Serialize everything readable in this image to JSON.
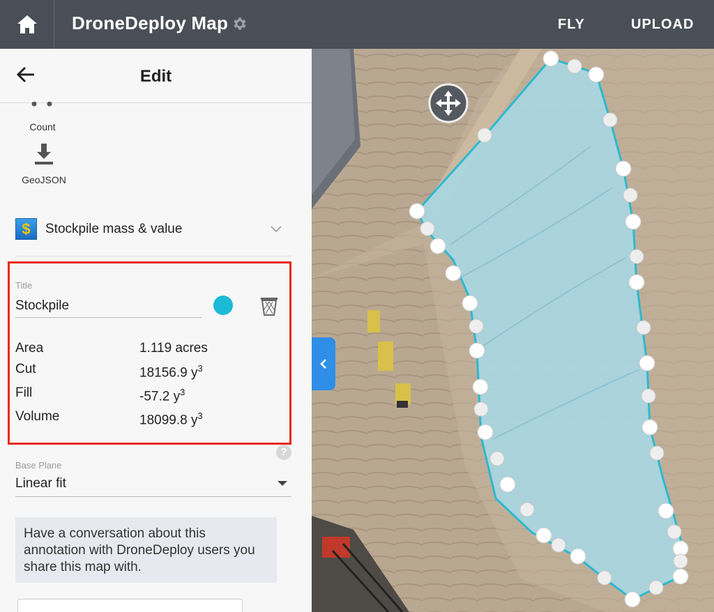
{
  "topbar": {
    "title": "DroneDeploy Map",
    "fly_label": "FLY",
    "upload_label": "UPLOAD",
    "icons": [
      "home-icon",
      "gear-icon"
    ],
    "background_color": "#4a4f57"
  },
  "sidebar": {
    "header": {
      "title": "Edit",
      "back_icon": "arrow-left-icon"
    },
    "tools": [
      {
        "label": "Count",
        "icon": "count-icon"
      },
      {
        "label": "GeoJSON",
        "icon": "download-icon"
      }
    ],
    "stockpile_section": {
      "label": "Stockpile mass & value",
      "icon": "dollar-icon"
    },
    "annotation": {
      "title_label": "Title",
      "title_value": "Stockpile",
      "color": "#1bbad6",
      "metrics": [
        {
          "label": "Area",
          "value": "1.119 acres",
          "sup": ""
        },
        {
          "label": "Cut",
          "value": "18156.9 y",
          "sup": "3"
        },
        {
          "label": "Fill",
          "value": "-57.2 y",
          "sup": "3"
        },
        {
          "label": "Volume",
          "value": "18099.8 y",
          "sup": "3"
        }
      ],
      "highlight_color": "#e8291c"
    },
    "base_plane": {
      "label": "Base Plane",
      "value": "Linear fit",
      "help_glyph": "?"
    },
    "conversation": {
      "text": "Have a conversation about this annotation with DroneDeploy users you share this map with."
    }
  },
  "map": {
    "collapse_icon": "chevron-left-icon",
    "move_icon": "move-icon",
    "polygon_color": "#1bbad6"
  }
}
